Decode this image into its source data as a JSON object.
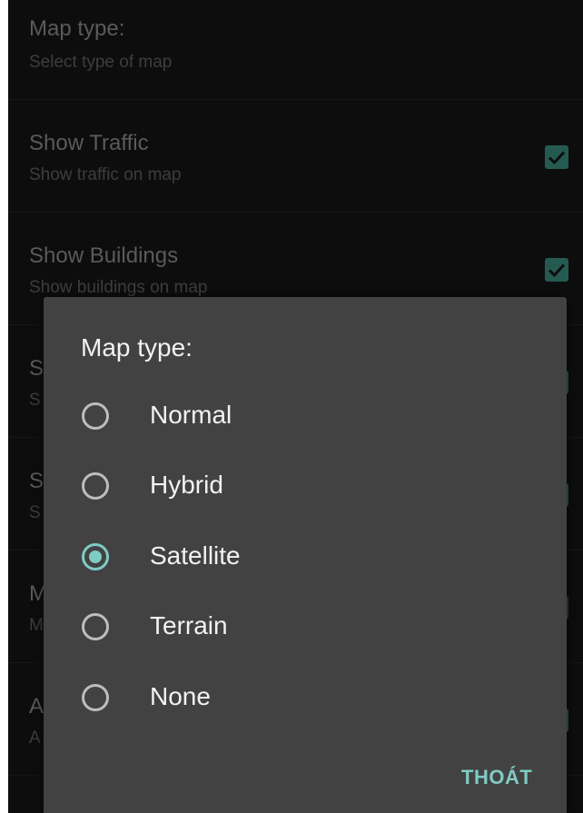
{
  "settings": {
    "items": [
      {
        "title": "Map type:",
        "summary": "Select type of map",
        "checkbox": "none"
      },
      {
        "title": "Show Traffic",
        "summary": "Show traffic on map",
        "checkbox": "checked"
      },
      {
        "title": "Show Buildings",
        "summary": "Show buildings on map",
        "checkbox": "checked"
      },
      {
        "title": "S",
        "summary": "S",
        "checkbox": "checked"
      },
      {
        "title": "S",
        "summary": "S",
        "checkbox": "checked"
      },
      {
        "title": "M",
        "summary": "M",
        "checkbox": "unchecked"
      },
      {
        "title": "A",
        "summary": "A",
        "checkbox": "checked"
      }
    ]
  },
  "dialog": {
    "title": "Map type:",
    "options": [
      {
        "label": "Normal",
        "selected": false
      },
      {
        "label": "Hybrid",
        "selected": false
      },
      {
        "label": "Satellite",
        "selected": true
      },
      {
        "label": "Terrain",
        "selected": false
      },
      {
        "label": "None",
        "selected": false
      }
    ],
    "dismiss_label": "THOÁT"
  },
  "colors": {
    "accent": "#80cbc4",
    "checkbox_fill": "#3a8a80",
    "dialog_bg": "#424242",
    "screen_bg": "#141414"
  }
}
